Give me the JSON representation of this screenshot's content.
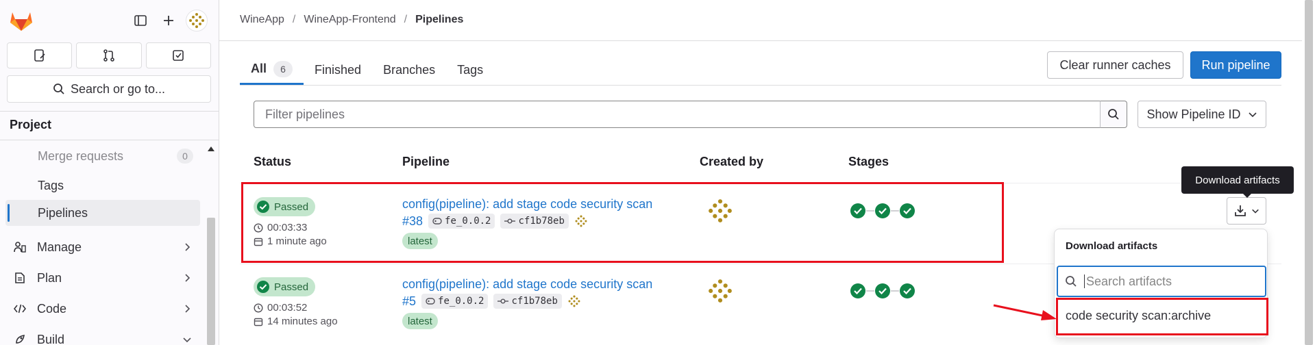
{
  "sidebar": {
    "search_label": "Search or go to...",
    "section_title": "Project",
    "items": [
      {
        "label": "Merge requests",
        "count": "0"
      },
      {
        "label": "Tags"
      },
      {
        "label": "Pipelines"
      },
      {
        "label": "Manage"
      },
      {
        "label": "Plan"
      },
      {
        "label": "Code"
      },
      {
        "label": "Build"
      }
    ]
  },
  "breadcrumb": [
    "WineApp",
    "WineApp-Frontend",
    "Pipelines"
  ],
  "tabs": [
    {
      "label": "All",
      "count": "6"
    },
    {
      "label": "Finished"
    },
    {
      "label": "Branches"
    },
    {
      "label": "Tags"
    }
  ],
  "actions": {
    "clear_caches": "Clear runner caches",
    "run_pipeline": "Run pipeline"
  },
  "filter": {
    "placeholder": "Filter pipelines",
    "show_id": "Show Pipeline ID"
  },
  "table": {
    "headers": [
      "Status",
      "Pipeline",
      "Created by",
      "Stages"
    ],
    "rows": [
      {
        "status": "Passed",
        "duration": "00:03:33",
        "finished": "1 minute ago",
        "title": "config(pipeline): add stage code security scan",
        "id": "#38",
        "ref": "fe_0.0.2",
        "commit": "cf1b78eb",
        "tag": "latest"
      },
      {
        "status": "Passed",
        "duration": "00:03:52",
        "finished": "14 minutes ago",
        "title": "config(pipeline): add stage code security scan",
        "id": "#5",
        "ref": "fe_0.0.2",
        "commit": "cf1b78eb",
        "tag": "latest"
      }
    ]
  },
  "artifacts": {
    "tooltip": "Download artifacts",
    "dropdown_title": "Download artifacts",
    "search_placeholder": "Search artifacts",
    "items": [
      "code security scan:archive"
    ]
  },
  "colors": {
    "primary": "#1f75cb",
    "success": "#108548",
    "success_bg": "#c3e6cd",
    "annotation": "#e8101d"
  },
  "icons": [
    "gitlab-logo",
    "sidebar-toggle-icon",
    "plus-icon",
    "issues-icon",
    "merge-request-icon",
    "todo-icon",
    "search-icon",
    "chevron-right-icon",
    "chevron-down-icon",
    "clock-icon",
    "calendar-icon",
    "tag-icon",
    "commit-icon",
    "check-circle-icon",
    "download-icon"
  ]
}
